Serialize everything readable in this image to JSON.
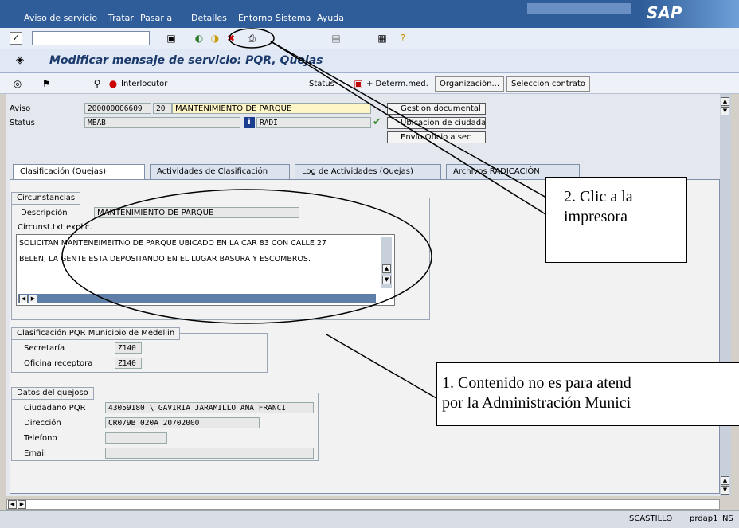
{
  "menu": [
    "Aviso de servicio",
    "Tratar",
    "Pasar a",
    "Detalles",
    "Entorno",
    "Sistema",
    "Ayuda"
  ],
  "brand": "SAP",
  "title": "Modificar mensaje de servicio: PQR, Quejas",
  "toolbar_buttons": {
    "interlocutor": "Interlocutor",
    "status": "Status",
    "determ": "+ Determ.med.",
    "organizacion": "Organización...",
    "seleccion": "Selección contrato"
  },
  "header": {
    "aviso_label": "Aviso",
    "aviso_num": "200000006609",
    "aviso_pos": "20",
    "aviso_desc": "MANTENIMIENTO DE PARQUE",
    "status_label": "Status",
    "status_value": "MEAB",
    "status_radi": "RADI"
  },
  "side_buttons": {
    "gestion": "Gestion documental",
    "ubicacion": "Ubicación de ciudada",
    "envio": "Envío Oficio a sec"
  },
  "tabs": [
    "Clasificación (Quejas)",
    "Actividades de Clasificación",
    "Log de Actividades (Quejas)",
    "Archivos RADICACIÓN"
  ],
  "circunstancias": {
    "title": "Circunstancias",
    "desc_label": "Descripción",
    "desc_value": "MANTENIMIENTO DE PARQUE",
    "txt_label": "Circunst.txt.explic.",
    "line1": "SOLICITAN MANTENEIMEITNO DE PARQUE UBICADO EN LA CAR 83  CON CALLE 27",
    "line2": "BELEN, LA GENTE ESTA DEPOSITANDO EN EL LUGAR BASURA Y ESCOMBROS."
  },
  "clasificacion": {
    "title": "Clasificación PQR Municipio de Medellin",
    "secretaria_label": "Secretaría",
    "secretaria_value": "Z140",
    "oficina_label": "Oficina receptora",
    "oficina_value": "Z140"
  },
  "quejoso": {
    "title": "Datos del quejoso",
    "ciudadano_label": "Ciudadano PQR",
    "ciudadano_value": "43059180   \\ GAVIRIA JARAMILLO ANA FRANCI",
    "direccion_label": "Dirección",
    "direccion_value": "CR079B 020A 20702000",
    "telefono_label": "Telefono",
    "email_label": "Email"
  },
  "callouts": {
    "c2_l1": "2. Clic a la",
    "c2_l2": "impresora",
    "c1_l1": "1. Contenido no es para atend",
    "c1_l2": "por la Administración Munici"
  },
  "statusbar": {
    "user": "SCASTILLO",
    "server": "prdap1",
    "mode": "INS"
  },
  "colors": {
    "menubar": "#2f5d9a",
    "title": "#1b3a6b"
  }
}
